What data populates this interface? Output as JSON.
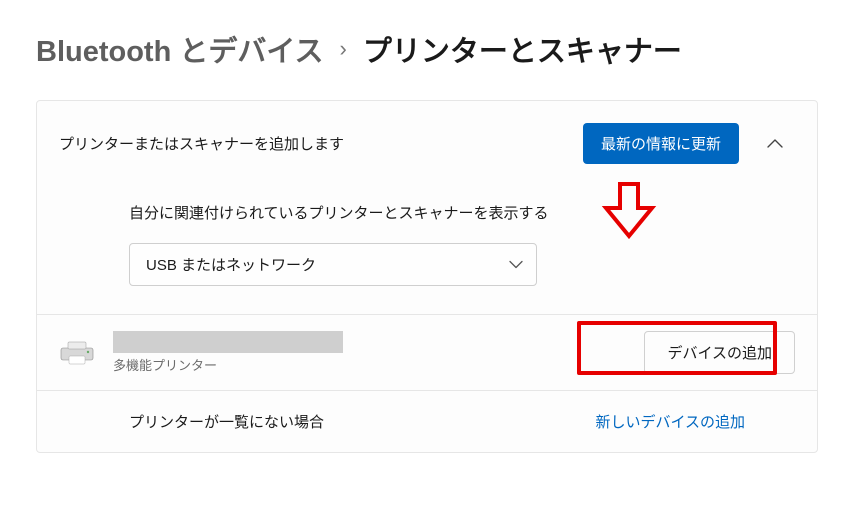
{
  "breadcrumb": {
    "parent": "Bluetooth とデバイス",
    "separator": "›",
    "current": "プリンターとスキャナー"
  },
  "addSection": {
    "title": "プリンターまたはスキャナーを追加します",
    "refreshButton": "最新の情報に更新"
  },
  "filter": {
    "label": "自分に関連付けられているプリンターとスキャナーを表示する",
    "selected": "USB またはネットワーク"
  },
  "printer": {
    "subtitle": "多機能プリンター",
    "addButton": "デバイスの追加"
  },
  "notListed": {
    "label": "プリンターが一覧にない場合",
    "action": "新しいデバイスの追加"
  },
  "colors": {
    "primary": "#0067c0",
    "highlight": "#e60000"
  }
}
